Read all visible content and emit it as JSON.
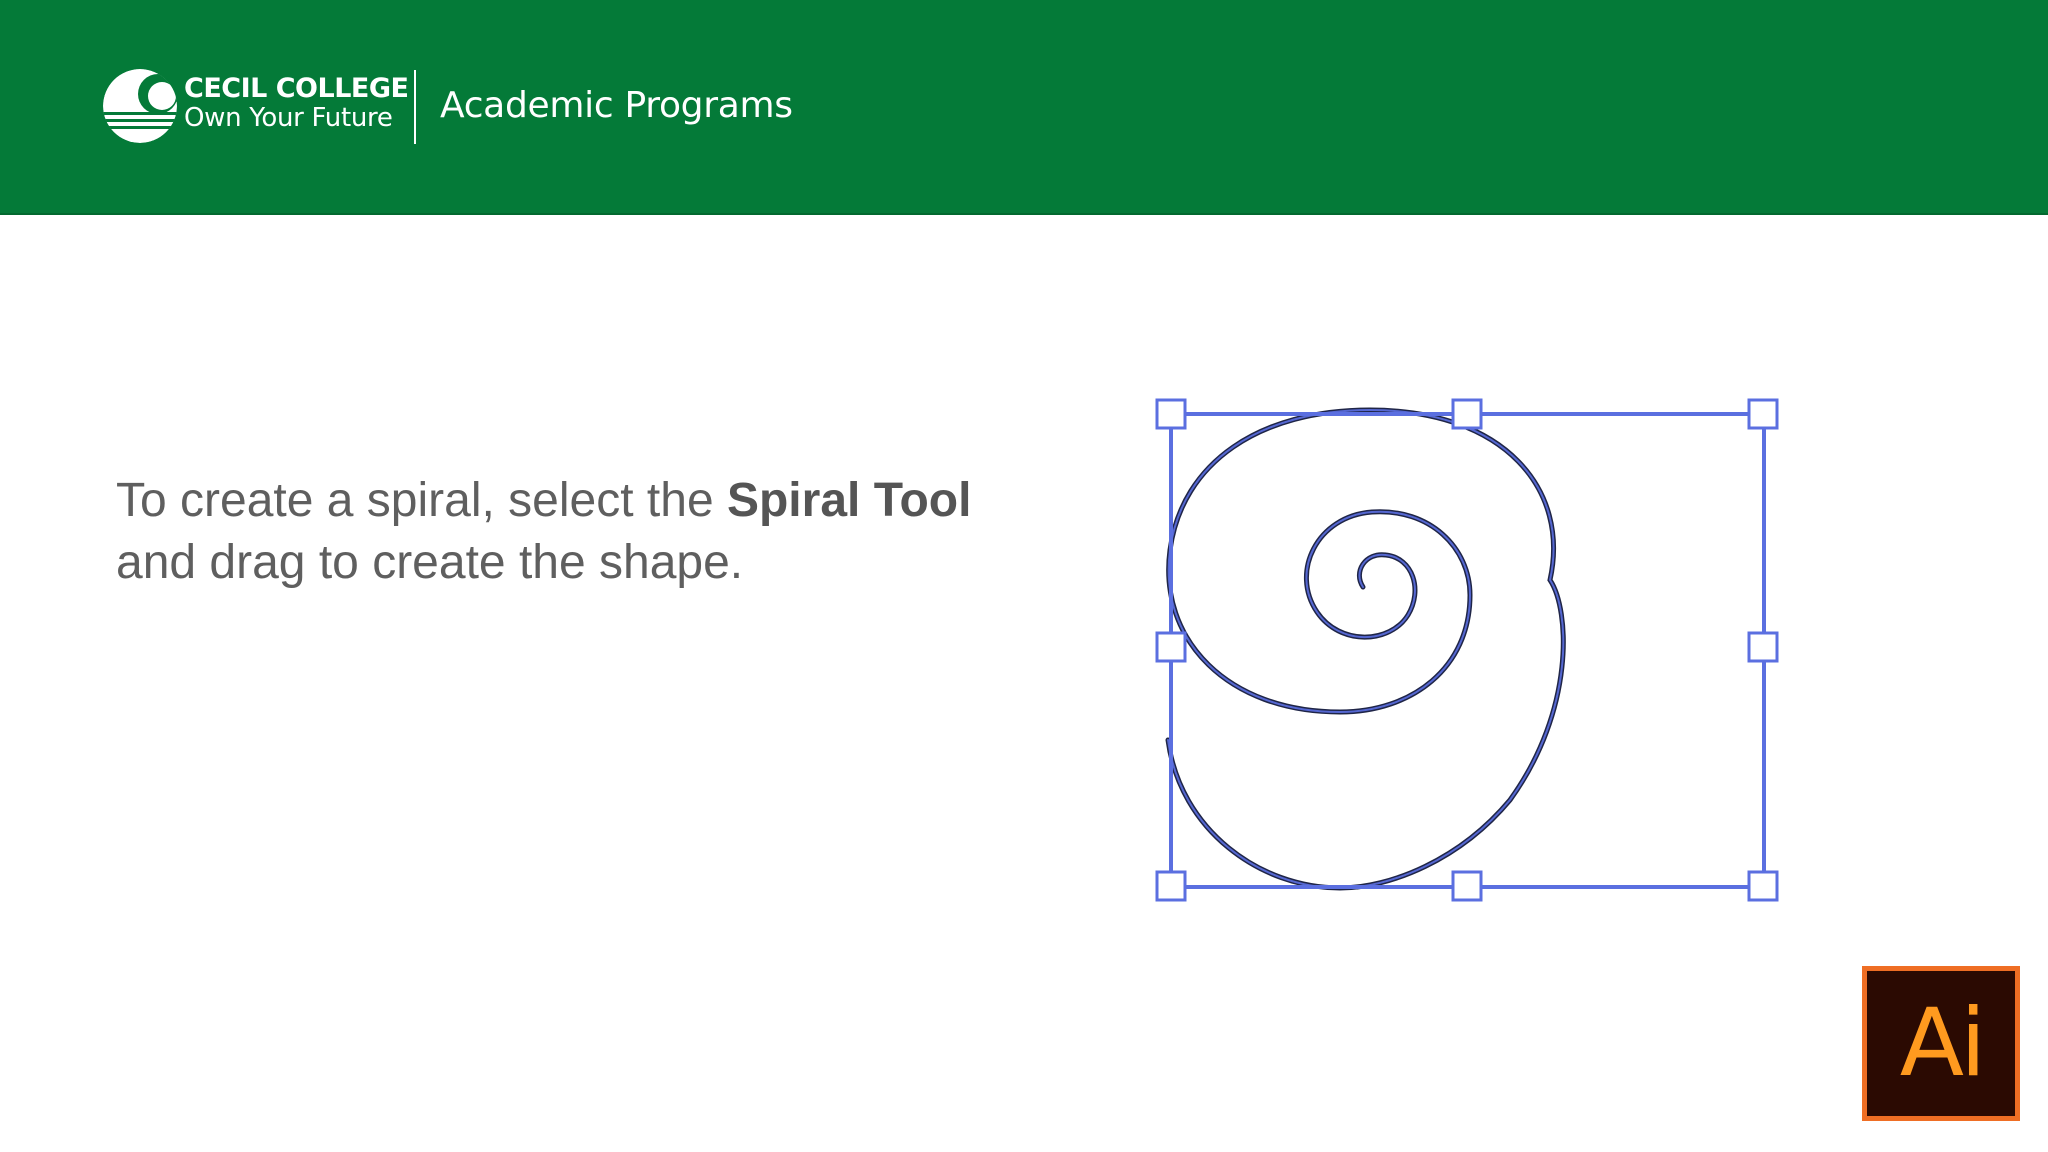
{
  "header": {
    "brand_name": "CECIL COLLEGE",
    "brand_tagline": "Own Your Future",
    "section_title": "Academic Programs",
    "background_color": "#047a38"
  },
  "main": {
    "instruction_part1": "To create a spiral, select the ",
    "instruction_tool": "Spiral Tool",
    "instruction_part2": "and drag to create the shape.",
    "illustration": {
      "icon": "spiral-shape-icon",
      "selection_color": "#5b6fe0"
    }
  },
  "app_badge": {
    "label": "Ai",
    "icon": "adobe-illustrator-icon",
    "border_color": "#ef6e24",
    "background_color": "#2b0a02",
    "text_color": "#ff9a1f"
  }
}
